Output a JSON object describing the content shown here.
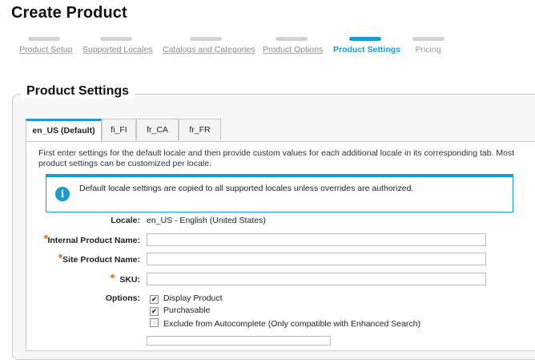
{
  "page_title": "Create Product",
  "steps": [
    {
      "label": "Product Setup",
      "state": "done"
    },
    {
      "label": "Supported Locales",
      "state": "done"
    },
    {
      "label": "Catalogs and Categories",
      "state": "done"
    },
    {
      "label": "Product Options",
      "state": "done"
    },
    {
      "label": "Product Settings",
      "state": "active"
    },
    {
      "label": "Pricing",
      "state": "future"
    }
  ],
  "colors": {
    "accent": "#1a9ad6",
    "required": "#ef8a21"
  },
  "panel": {
    "title": "Product Settings"
  },
  "tabs": [
    {
      "label": "en_US (Default)",
      "active": true
    },
    {
      "label": "fi_FI",
      "active": false
    },
    {
      "label": "fr_CA",
      "active": false
    },
    {
      "label": "fr_FR",
      "active": false
    }
  ],
  "intro_text": "First enter settings for the default locale and then provide custom values for each additional locale in its corresponding tab. Most product settings can be customized per locale.",
  "info": {
    "icon": "info-icon",
    "text": "Default locale settings are copied to all supported locales unless overrides are authorized."
  },
  "form": {
    "locale": {
      "label": "Locale:",
      "value": "en_US - English (United States)"
    },
    "internal_name": {
      "label": "Internal Product Name:",
      "value": "",
      "required": true
    },
    "site_name": {
      "label": "Site Product Name:",
      "value": "",
      "required": true
    },
    "sku": {
      "label": "SKU:",
      "value": "",
      "required": true
    },
    "options": {
      "label": "Options:",
      "items": [
        {
          "label": "Display Product",
          "checked": true
        },
        {
          "label": "Purchasable",
          "checked": true
        },
        {
          "label": "Exclude from Autocomplete (Only compatible with Enhanced Search)",
          "checked": false
        }
      ]
    }
  }
}
